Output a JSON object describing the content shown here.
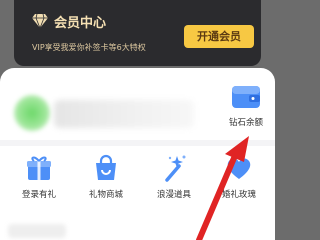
{
  "vip": {
    "title": "会员中心",
    "subtitle": "VIP享受我爱你补签卡等6大特权",
    "button_label": "开通会员"
  },
  "quick": {
    "diamond_balance_label": "钻石余额"
  },
  "grid": {
    "items": [
      {
        "label": "登录有礼",
        "icon": "gift-icon"
      },
      {
        "label": "礼物商城",
        "icon": "shopping-bag-icon"
      },
      {
        "label": "浪漫道具",
        "icon": "magic-wand-icon"
      },
      {
        "label": "婚礼玫瑰",
        "icon": "heart-icon"
      }
    ]
  },
  "colors": {
    "accent": "#3b7ff5",
    "vip_gold": "#f7c843",
    "arrow": "#e02424"
  }
}
